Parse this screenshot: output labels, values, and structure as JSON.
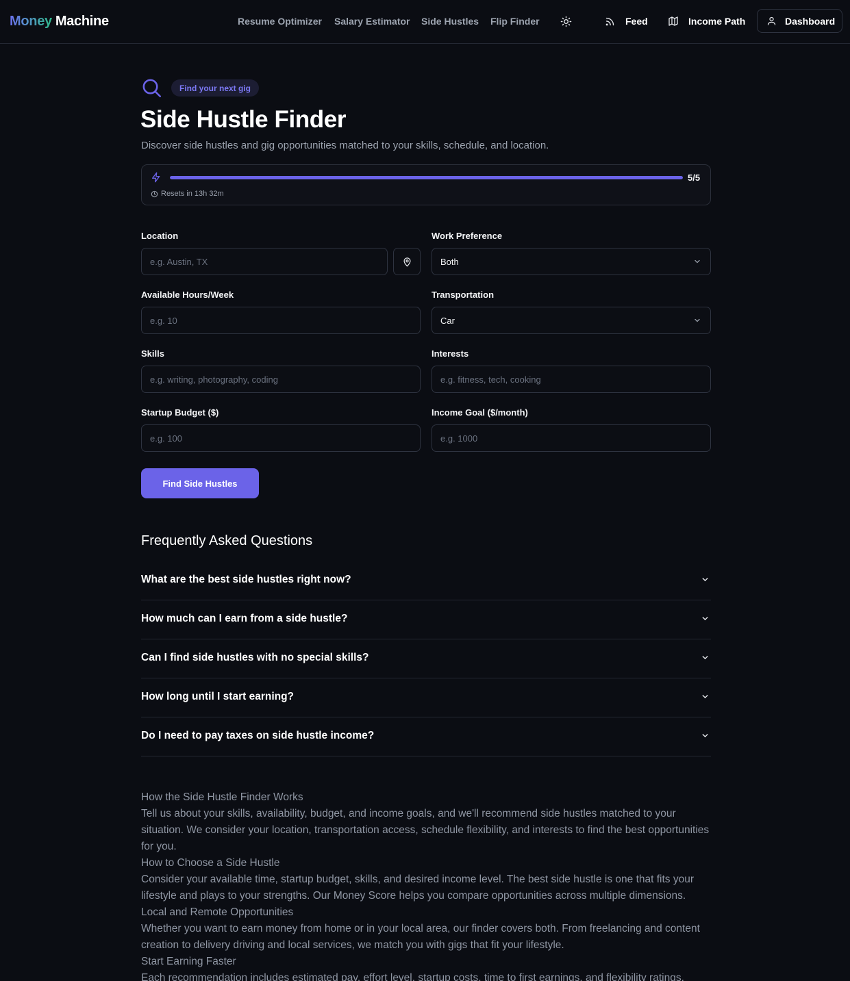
{
  "nav": {
    "brand_part1": "Money",
    "brand_part2": "Machine",
    "links": [
      "Resume Optimizer",
      "Salary Estimator",
      "Side Hustles",
      "Flip Finder"
    ],
    "theme_icon": "sun-icon",
    "feed_label": "Feed",
    "feed_icon": "rss-icon",
    "income_path_label": "Income Path",
    "income_path_icon": "map-icon",
    "dashboard_label": "Dashboard",
    "dashboard_icon": "user-icon"
  },
  "header": {
    "pill": "Find your next gig",
    "title": "Side Hustle Finder",
    "subtitle": "Discover side hustles and gig opportunities matched to your skills, schedule, and location."
  },
  "usage": {
    "used": 5,
    "limit": 5,
    "count_label": "5/5",
    "fill_fraction": 1.0,
    "resets": "Resets in 13h 32m"
  },
  "form": {
    "location": {
      "label": "Location",
      "placeholder": "e.g. Austin, TX",
      "value": ""
    },
    "work_preference": {
      "label": "Work Preference",
      "value": "Both"
    },
    "hours": {
      "label": "Available Hours/Week",
      "placeholder": "e.g. 10",
      "value": ""
    },
    "transportation": {
      "label": "Transportation",
      "value": "Car"
    },
    "skills": {
      "label": "Skills",
      "placeholder": "e.g. writing, photography, coding",
      "value": ""
    },
    "interests": {
      "label": "Interests",
      "placeholder": "e.g. fitness, tech, cooking",
      "value": ""
    },
    "budget": {
      "label": "Startup Budget ($)",
      "placeholder": "e.g. 100",
      "value": ""
    },
    "income_goal": {
      "label": "Income Goal ($/month)",
      "placeholder": "e.g. 1000",
      "value": ""
    },
    "submit_label": "Find Side Hustles"
  },
  "faq": {
    "title": "Frequently Asked Questions",
    "items": [
      "What are the best side hustles right now?",
      "How much can I earn from a side hustle?",
      "Can I find side hustles with no special skills?",
      "How long until I start earning?",
      "Do I need to pay taxes on side hustle income?"
    ]
  },
  "article": {
    "sections": [
      {
        "heading": "How the Side Hustle Finder Works",
        "body": "Tell us about your skills, availability, budget, and income goals, and we'll recommend side hustles matched to your situation. We consider your location, transportation access, schedule flexibility, and interests to find the best opportunities for you."
      },
      {
        "heading": "How to Choose a Side Hustle",
        "body": "Consider your available time, startup budget, skills, and desired income level. The best side hustle is one that fits your lifestyle and plays to your strengths. Our Money Score helps you compare opportunities across multiple dimensions."
      },
      {
        "heading": "Local and Remote Opportunities",
        "body": "Whether you want to earn money from home or in your local area, our finder covers both. From freelancing and content creation to delivery driving and local services, we match you with gigs that fit your lifestyle."
      },
      {
        "heading": "Start Earning Faster",
        "body": "Each recommendation includes estimated pay, effort level, startup costs, time to first earnings, and flexibility ratings."
      }
    ]
  }
}
